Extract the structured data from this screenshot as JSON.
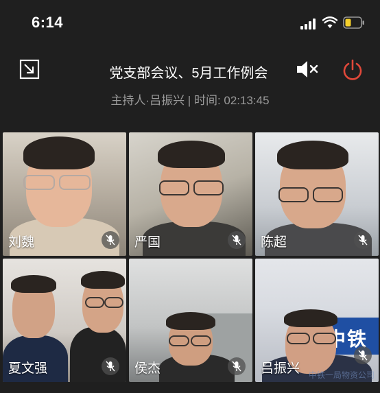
{
  "status_bar": {
    "time": "6:14"
  },
  "header": {
    "title": "党支部会议、5月工作例会",
    "subtitle": "主持人·吕振兴 | 时间: 02:13:45"
  },
  "icons": {
    "exit_fullscreen": "exit-fullscreen-icon",
    "speaker_muted": "speaker-muted-icon",
    "power": "power-icon",
    "mic_muted": "mic-muted-icon"
  },
  "colors": {
    "power": "#e0483a",
    "background": "#1f1f1f",
    "subtitle": "#9a9a9a"
  },
  "participants": [
    {
      "name": "刘魏"
    },
    {
      "name": "严国"
    },
    {
      "name": "陈超"
    },
    {
      "name": "夏文强"
    },
    {
      "name": "侯杰"
    },
    {
      "name": "吕振兴",
      "sign": "中铁",
      "watermark": "中铁一局物资公司"
    }
  ]
}
